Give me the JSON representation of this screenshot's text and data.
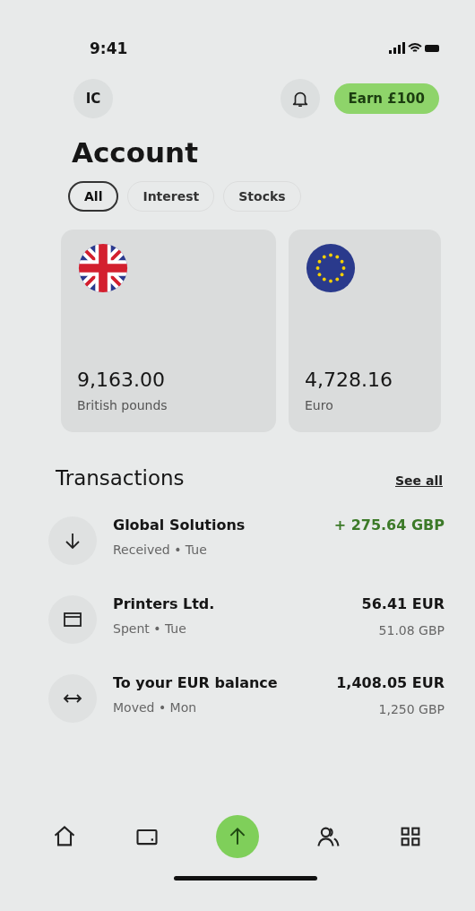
{
  "status_bar": {
    "time": "9:41"
  },
  "header": {
    "avatar_initials": "IC",
    "earn_button": "Earn £100"
  },
  "title": "Account",
  "filters": [
    {
      "label": "All",
      "selected": true
    },
    {
      "label": "Interest",
      "selected": false
    },
    {
      "label": "Stocks",
      "selected": false
    }
  ],
  "balances": [
    {
      "kind": "gbp",
      "amount": "9,163.00",
      "currency": "British pounds"
    },
    {
      "kind": "eur",
      "amount": "4,728.16",
      "currency": "Euro"
    }
  ],
  "transactions": {
    "title": "Transactions",
    "see_all": "See all",
    "items": [
      {
        "kind": "received",
        "name": "Global Solutions",
        "detail": "Received • Tue",
        "amount": "+ 275.64 GBP"
      },
      {
        "kind": "spent",
        "name": "Printers Ltd.",
        "detail": "Spent • Tue",
        "amount": "56.41 EUR",
        "converted": "51.08 GBP"
      },
      {
        "kind": "moved",
        "name": "To your EUR balance",
        "detail": "Moved • Mon",
        "amount": "1,408.05 EUR",
        "converted": "1,250 GBP"
      }
    ]
  },
  "nav": [
    {
      "kind": "home"
    },
    {
      "kind": "card"
    },
    {
      "kind": "send"
    },
    {
      "kind": "people"
    },
    {
      "kind": "grid"
    }
  ]
}
